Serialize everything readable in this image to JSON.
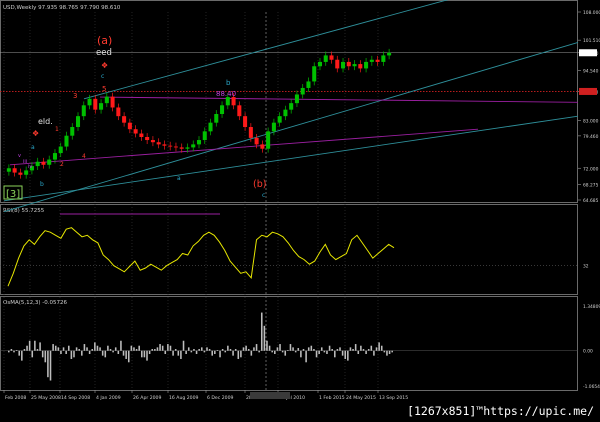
{
  "window": {
    "main_header": "USD,Weekly  97.935 98.765 97.790 98.610",
    "rsi_header": "RSI(8) 55.7255",
    "osma_header": "OsMA(5,12,3) -0.05726",
    "watermark": "[1267x851]™https://upic.me/"
  },
  "colors": {
    "background": "#000000",
    "grid": "#3a3a3a",
    "candle_up": "#00c000",
    "candle_down": "#ff1a1a",
    "channel": "#2e8f9a",
    "magenta_line": "#9a1fa0",
    "rsi_line": "#e6e600",
    "osma_bars": "#bdbdbd",
    "wave_red": "#ff3b2f",
    "wave_cyan": "#2aa7c9",
    "wave_magenta": "#c040e0",
    "wave_label_white": "#e0e0e0",
    "box_green": "#8bd35a"
  },
  "chart_data": [
    {
      "type": "candlestick",
      "x_tick_labels": [
        "Feb 2008",
        "25 May 2008",
        "14 Sep 2008",
        "4 Jan 2009",
        "26 Apr 2009",
        "16 Aug 2009",
        "6 Dec 2009",
        "28 Mar 2010",
        "18 Jul 2010",
        "1 Feb 2015",
        "24 May 2015",
        "13 Sep 2015"
      ],
      "y_tick_labels": [
        "108.000",
        "101.510",
        "98.610",
        "94.540",
        "89.695",
        "83.000",
        "79.460",
        "72.000",
        "68.275",
        "64.685"
      ],
      "ylim": [
        64.685,
        108.0
      ],
      "current_price": 98.61,
      "marked_level": 89.695,
      "closes": [
        72,
        71,
        70.5,
        71.5,
        72.5,
        73.5,
        72.8,
        74,
        75.5,
        77,
        79.5,
        81.5,
        84,
        86.5,
        88,
        85.5,
        87,
        88.5,
        86,
        84,
        82.5,
        81,
        80,
        79.2,
        78.5,
        78,
        77.5,
        77.2,
        77,
        76.8,
        76.5,
        76.8,
        77.5,
        78.5,
        80.5,
        82.5,
        84.5,
        86.5,
        88.4,
        86.5,
        84,
        81.5,
        79,
        77.5,
        76.5,
        80.5,
        82.5,
        84,
        85.5,
        87,
        89,
        90.5,
        92,
        95.5,
        96.5,
        98,
        97,
        95,
        96.5,
        95.5,
        96,
        95,
        96.5,
        97,
        96.5,
        98,
        98.6
      ],
      "annotations": [
        {
          "text": "(a)",
          "color": "#ff3b2f"
        },
        {
          "text": "eed",
          "color": "#e0e0e0"
        },
        {
          "text": "❖",
          "color": "#ff3b2f"
        },
        {
          "text": "c",
          "color": "#2aa7c9"
        },
        {
          "text": "5",
          "color": "#ff3b2f"
        },
        {
          "text": "3",
          "color": "#ff3b2f"
        },
        {
          "text": "b",
          "color": "#2aa7c9"
        },
        {
          "text": "88.40",
          "color": "#c040e0"
        },
        {
          "text": "eld.",
          "color": "#e0e0e0"
        },
        {
          "text": "❖",
          "color": "#ff3b2f"
        },
        {
          "text": "a",
          "color": "#2aa7c9"
        },
        {
          "text": "1",
          "color": "#ff3b2f"
        },
        {
          "text": "4",
          "color": "#ff3b2f"
        },
        {
          "text": "2",
          "color": "#ff3b2f"
        },
        {
          "text": "v",
          "color": "#c040e0"
        },
        {
          "text": "iii",
          "color": "#c040e0"
        },
        {
          "text": "iv",
          "color": "#c040e0"
        },
        {
          "text": "b",
          "color": "#2aa7c9"
        },
        {
          "text": "a",
          "color": "#2aa7c9"
        },
        {
          "text": "c",
          "color": "#2aa7c9"
        },
        {
          "text": "(b)",
          "color": "#ff3b2f"
        },
        {
          "text": "[3]",
          "color": "#8bd35a"
        }
      ]
    },
    {
      "type": "line",
      "name": "RSI(8)",
      "current": 55.7255,
      "y_tick_labels": [
        "32"
      ],
      "ylim": [
        0,
        100
      ],
      "values": [
        5,
        22,
        42,
        58,
        66,
        60,
        70,
        78,
        76,
        72,
        68,
        80,
        82,
        76,
        70,
        72,
        66,
        62,
        46,
        40,
        32,
        28,
        24,
        31,
        38,
        26,
        29,
        34,
        30,
        26,
        32,
        36,
        40,
        48,
        46,
        58,
        64,
        72,
        76,
        72,
        63,
        52,
        38,
        30,
        22,
        24,
        16,
        66,
        72,
        70,
        76,
        74,
        70,
        62,
        52,
        44,
        40,
        34,
        38,
        50,
        60,
        46,
        40,
        44,
        48,
        66,
        72,
        62,
        52,
        42,
        48,
        54,
        60,
        55.7
      ]
    },
    {
      "type": "bar",
      "name": "OsMA(5,12,3)",
      "current": -0.05726,
      "y_tick_labels": [
        "1.34809",
        "0.00",
        "-1.06541"
      ],
      "ylim": [
        -1.06541,
        1.34809
      ],
      "values": [
        -0.05,
        0.05,
        -0.05,
        0.02,
        -0.15,
        -0.3,
        0.05,
        0.15,
        0.3,
        -0.2,
        0.3,
        0.05,
        0.25,
        -0.2,
        -0.35,
        -0.8,
        -0.9,
        0.2,
        0.15,
        0.1,
        -0.1,
        0.1,
        -0.1,
        0.15,
        -0.25,
        -0.2,
        0.1,
        0.05,
        -0.15,
        0.2,
        0.1,
        -0.1,
        0.05,
        0.25,
        0.15,
        0.1,
        -0.15,
        -0.2,
        0.15,
        0.05,
        -0.05,
        0.1,
        -0.1,
        0.3,
        -0.15,
        -0.25,
        -0.35,
        0.15,
        0.1,
        0.05,
        0.15,
        -0.2,
        -0.2,
        -0.3,
        -0.1,
        0.05,
        0.05,
        0.1,
        0.2,
        0.15,
        -0.1,
        0.2,
        0.15,
        -0.15,
        0.05,
        -0.15,
        -0.25,
        0.3,
        -0.1,
        0.1,
        -0.05,
        0.05,
        -0.1,
        0.05,
        0.1,
        -0.05,
        0.1,
        0.05,
        -0.15,
        -0.1,
        0.02,
        -0.2,
        0.05,
        -0.05,
        0.15,
        0.05,
        -0.15,
        0.05,
        -0.25,
        -0.2,
        0.1,
        0.15,
        0.05,
        -0.15,
        0.1,
        0.2,
        -0.05,
        1.15,
        0.75,
        0.3,
        0.15,
        -0.05,
        -0.1,
        0.1,
        0.2,
        -0.05,
        -0.15,
        0.02,
        0.2,
        0.1,
        -0.05,
        0.08,
        -0.2,
        0.05,
        -0.35,
        0.1,
        0.15,
        0.05,
        -0.2,
        -0.1,
        0.1,
        -0.05,
        -0.1,
        0.15,
        0.05,
        -0.2,
        0.05,
        0.1,
        -0.15,
        -0.25,
        -0.3,
        0.1,
        0.05,
        0.2,
        -0.1,
        0.15,
        0.05,
        -0.1,
        0.05,
        0.15,
        -0.15,
        0.1,
        0.25,
        0.15,
        -0.05,
        -0.15,
        -0.1,
        -0.05
      ]
    }
  ]
}
